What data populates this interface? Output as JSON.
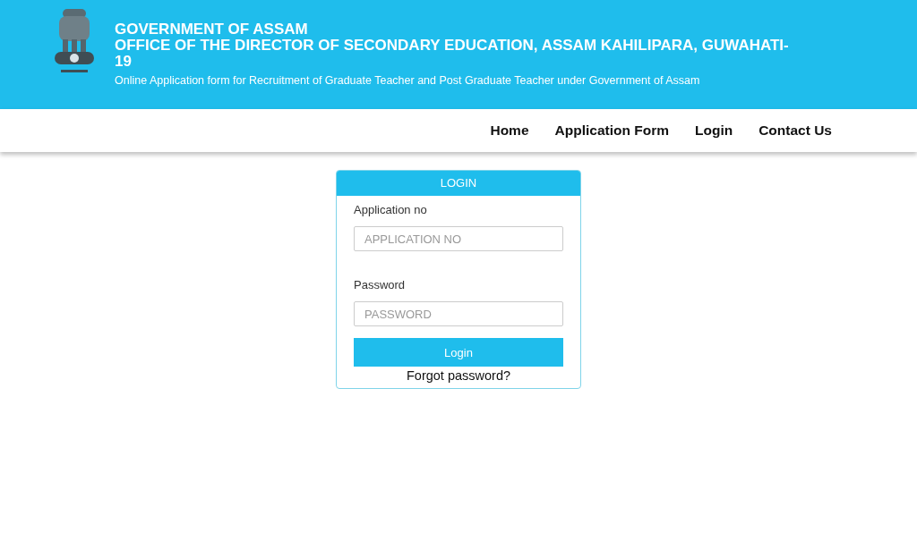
{
  "header": {
    "title": "GOVERNMENT OF ASSAM",
    "office": "OFFICE OF THE DIRECTOR OF SECONDARY EDUCATION, ASSAM KAHILIPARA, GUWAHATI-19",
    "subtitle": "Online Application form for Recruitment of Graduate Teacher and Post Graduate Teacher under Government of Assam"
  },
  "nav": [
    {
      "label": "Home"
    },
    {
      "label": "Application Form"
    },
    {
      "label": "Login"
    },
    {
      "label": "Contact Us"
    }
  ],
  "login": {
    "title": "LOGIN",
    "fields": [
      {
        "label": "Application no",
        "placeholder": "APPLICATION NO"
      },
      {
        "label": "Password",
        "placeholder": "PASSWORD"
      }
    ],
    "button": "Login",
    "forgot": "Forgot password?"
  }
}
